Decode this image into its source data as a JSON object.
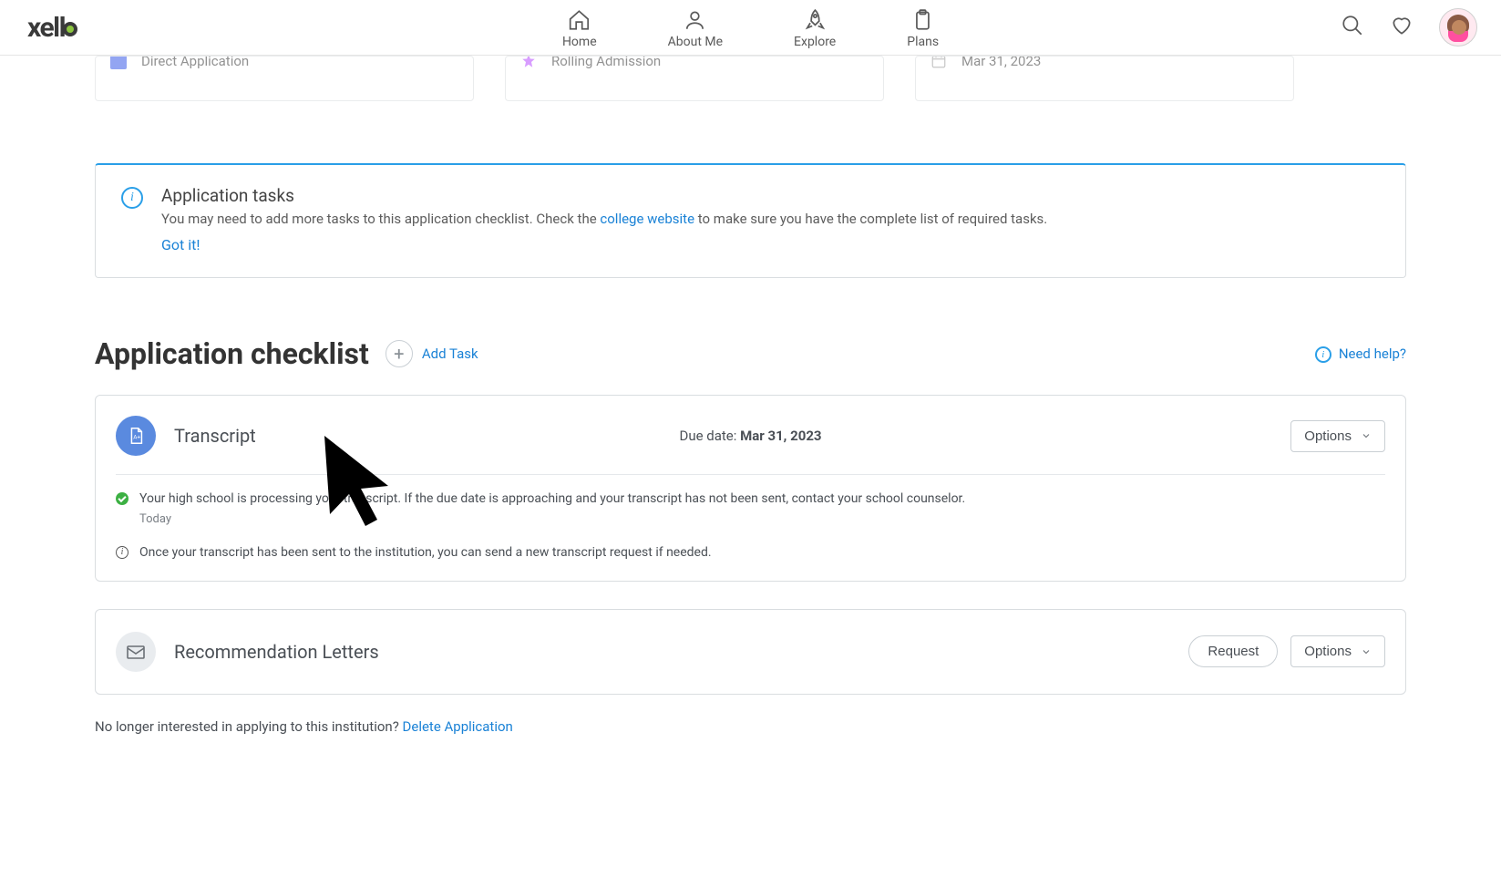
{
  "header": {
    "logo_text": "xell",
    "nav": {
      "home": "Home",
      "about": "About Me",
      "explore": "Explore",
      "plans": "Plans"
    }
  },
  "top_cards": {
    "direct": "Direct Application",
    "rolling": "Rolling Admission",
    "date": "Mar 31, 2023"
  },
  "info_banner": {
    "title": "Application tasks",
    "text_before_link": "You may need to add more tasks to this application checklist. Check the ",
    "link_text": "college website",
    "text_after_link": " to make sure you have the complete list of required tasks.",
    "gotit": "Got it!"
  },
  "section": {
    "heading": "Application checklist",
    "add_task": "Add Task",
    "need_help": "Need help?"
  },
  "transcript": {
    "title": "Transcript",
    "due_label": "Due date: ",
    "due_value": "Mar 31, 2023",
    "options": "Options",
    "status_text": "Your high school is processing your transcript. If the due date is approaching and your transcript has not been sent, contact your school counselor.",
    "status_sub": "Today",
    "info_text": "Once your transcript has been sent to the institution, you can send a new transcript request if needed."
  },
  "letters": {
    "title": "Recommendation Letters",
    "request": "Request",
    "options": "Options"
  },
  "footer": {
    "text": "No longer interested in applying to this institution? ",
    "link": "Delete Application"
  }
}
